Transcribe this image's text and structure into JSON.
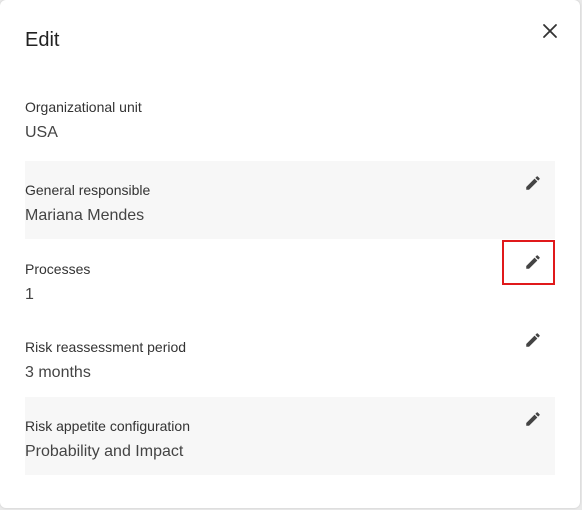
{
  "dialog": {
    "title": "Edit",
    "close_icon": "close-icon"
  },
  "sections": [
    {
      "label": "Organizational unit",
      "value": "USA",
      "editable": false
    },
    {
      "label": "General responsible",
      "value": "Mariana Mendes",
      "editable": true,
      "icon": "pencil-icon"
    },
    {
      "label": "Processes",
      "value": "1",
      "editable": true,
      "icon": "pencil-icon"
    },
    {
      "label": "Risk reassessment period",
      "value": "3 months",
      "editable": true,
      "icon": "pencil-icon"
    },
    {
      "label": "Risk appetite configuration",
      "value": "Probability and Impact",
      "editable": true,
      "icon": "pencil-icon"
    }
  ],
  "colors": {
    "highlight": "#e0191b",
    "shaded_row": "#f7f7f7"
  }
}
